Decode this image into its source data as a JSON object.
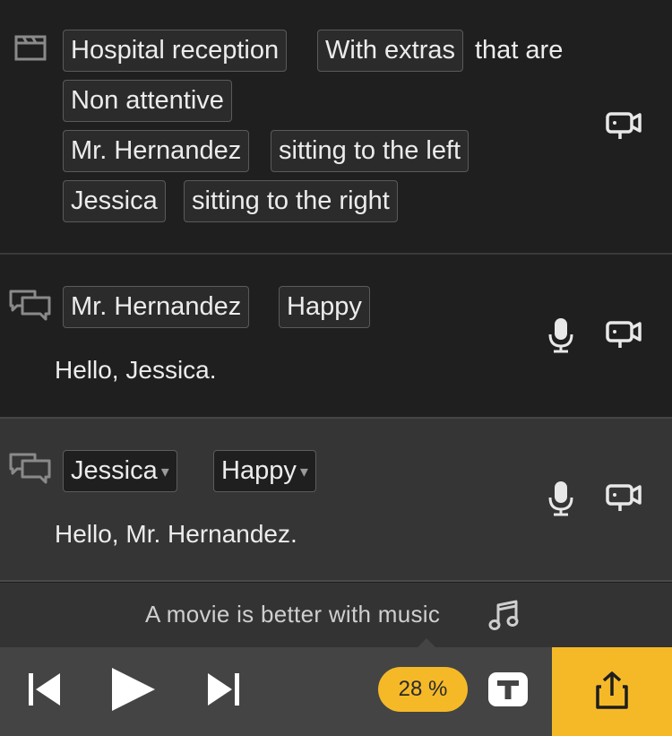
{
  "scene": {
    "location": "Hospital reception",
    "extras_option": "With extras",
    "extras_suffix": "that are",
    "extras_state": "Non attentive",
    "characters": [
      {
        "name": "Mr. Hernandez",
        "position": "sitting to the left"
      },
      {
        "name": "Jessica",
        "position": "sitting to the right"
      }
    ],
    "scene_icon": "clapperboard-icon",
    "camera_icon": "camera-icon"
  },
  "dialogs": [
    {
      "character": "Mr. Hernandez",
      "emotion": "Happy",
      "line": "Hello, Jessica.",
      "editable": false
    },
    {
      "character": "Jessica",
      "emotion": "Happy",
      "line": "Hello, Mr. Hernandez.",
      "editable": true,
      "dropdown_glyph": "▾"
    }
  ],
  "music_prompt": "A movie is better with music",
  "player": {
    "progress": "28 %",
    "progress_value": 0.28,
    "t_label": "T"
  },
  "colors": {
    "accent": "#f5b928",
    "background": "#1f1f1f",
    "selected_row": "#353535",
    "toolbar": "#444444"
  }
}
